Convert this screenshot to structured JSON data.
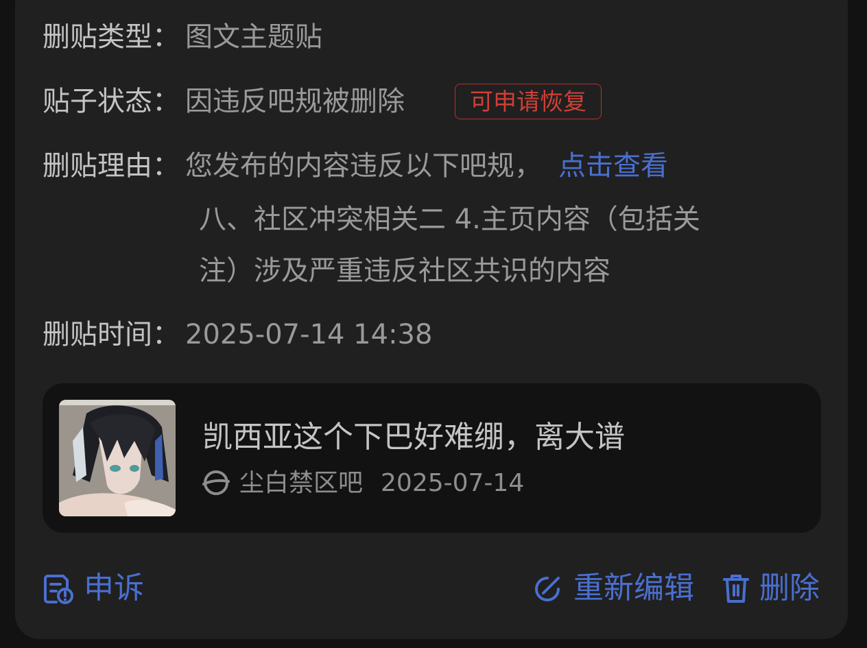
{
  "details": {
    "type_label": "删贴类型：",
    "type_value": "图文主题贴",
    "status_label": "贴子状态：",
    "status_value": "因违反吧规被删除",
    "status_badge": "可申请恢复",
    "reason_label": "删贴理由：",
    "reason_line1": "您发布的内容违反以下吧规，",
    "reason_link": "点击查看",
    "reason_line2": "八、社区冲突相关二 4.主页内容（包括关",
    "reason_line3": "注）涉及严重违反社区共识的内容",
    "time_label": "删贴时间：",
    "time_value": "2025-07-14 14:38"
  },
  "post": {
    "title": "凯西亚这个下巴好难绷，离大谱",
    "forum": "尘白禁区吧",
    "date": "2025-07-14",
    "forum_icon": "planet-icon"
  },
  "actions": {
    "appeal": "申诉",
    "reedit": "重新编辑",
    "delete": "删除"
  },
  "colors": {
    "accent": "#4a6fd0",
    "badge_red": "#cf3f35",
    "card_bg": "#202020",
    "post_bg": "#121212"
  }
}
